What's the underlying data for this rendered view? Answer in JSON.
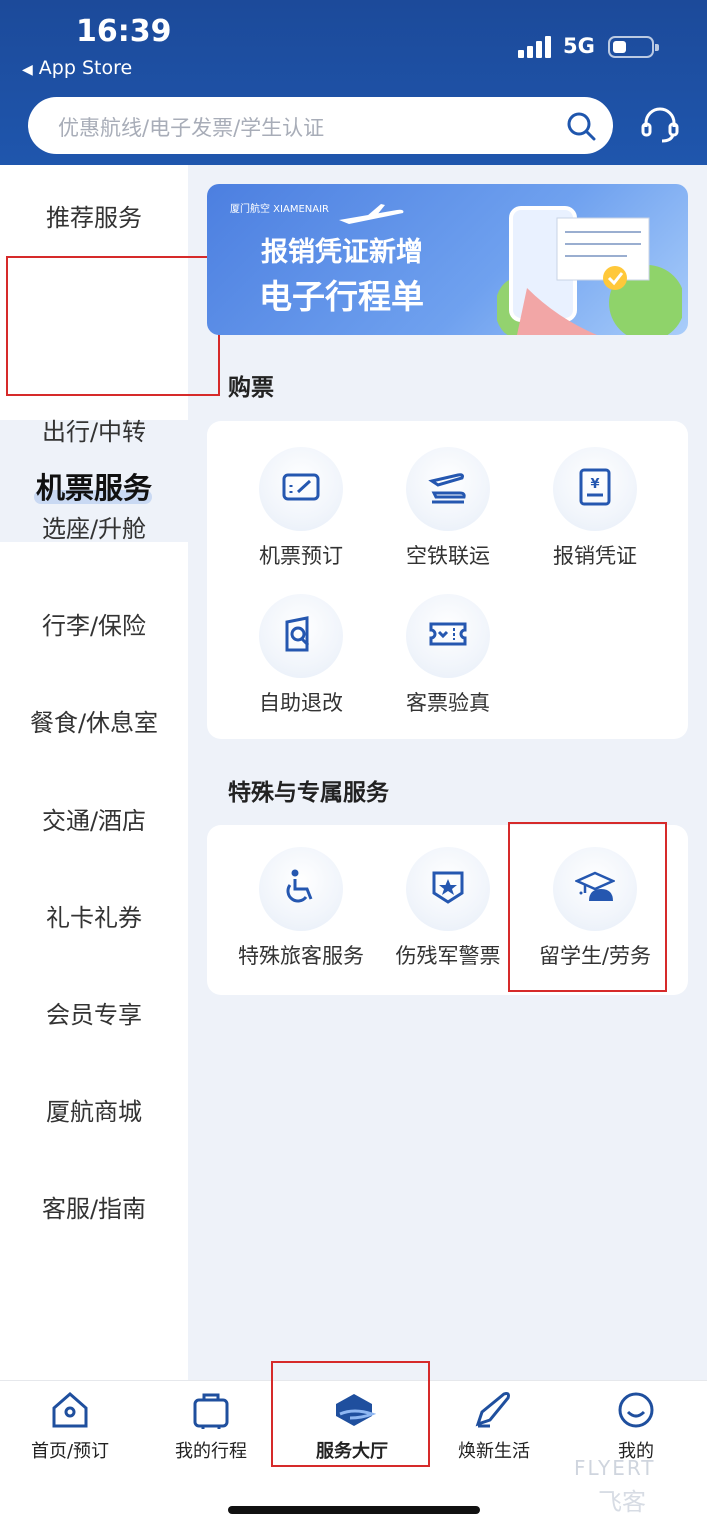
{
  "status_bar": {
    "time": "16:39",
    "back_app": "App Store",
    "network": "5G"
  },
  "search": {
    "placeholder": "优惠航线/电子发票/学生认证"
  },
  "sidebar": {
    "items": [
      {
        "label": "推荐服务"
      },
      {
        "label": "机票服务",
        "active": true
      },
      {
        "label": "出行/中转"
      },
      {
        "label": "选座/升舱"
      },
      {
        "label": "行李/保险"
      },
      {
        "label": "餐食/休息室"
      },
      {
        "label": "交通/酒店"
      },
      {
        "label": "礼卡礼券"
      },
      {
        "label": "会员专享"
      },
      {
        "label": "厦航商城"
      },
      {
        "label": "客服/指南"
      }
    ]
  },
  "banner": {
    "logo": "厦门航空 XIAMENAIR",
    "line1": "报销凭证新增",
    "line2": "电子行程单"
  },
  "sections": {
    "purchase": {
      "title": "购票",
      "tiles": [
        {
          "label": "机票预订",
          "icon": "ticket-booking-icon"
        },
        {
          "label": "空铁联运",
          "icon": "air-rail-icon"
        },
        {
          "label": "报销凭证",
          "icon": "receipt-icon"
        },
        {
          "label": "自助退改",
          "icon": "self-refund-icon"
        },
        {
          "label": "客票验真",
          "icon": "ticket-verify-icon"
        }
      ]
    },
    "special": {
      "title": "特殊与专属服务",
      "tiles": [
        {
          "label": "特殊旅客服务",
          "icon": "wheelchair-icon"
        },
        {
          "label": "伤残军警票",
          "icon": "military-badge-icon"
        },
        {
          "label": "留学生/劳务",
          "icon": "student-worker-icon"
        }
      ]
    }
  },
  "bottom_nav": {
    "items": [
      {
        "label": "首页/预订",
        "icon": "home-icon"
      },
      {
        "label": "我的行程",
        "icon": "luggage-icon"
      },
      {
        "label": "服务大厅",
        "icon": "service-hall-icon",
        "active": true
      },
      {
        "label": "焕新生活",
        "icon": "plane-life-icon"
      },
      {
        "label": "我的",
        "icon": "smile-icon"
      }
    ]
  },
  "watermark": {
    "text": "FLYERT",
    "sub": "飞客"
  },
  "colors": {
    "header": "#1f56ad",
    "accent": "#2557b0",
    "highlight": "#d62a2a",
    "background": "#eef2f9"
  }
}
